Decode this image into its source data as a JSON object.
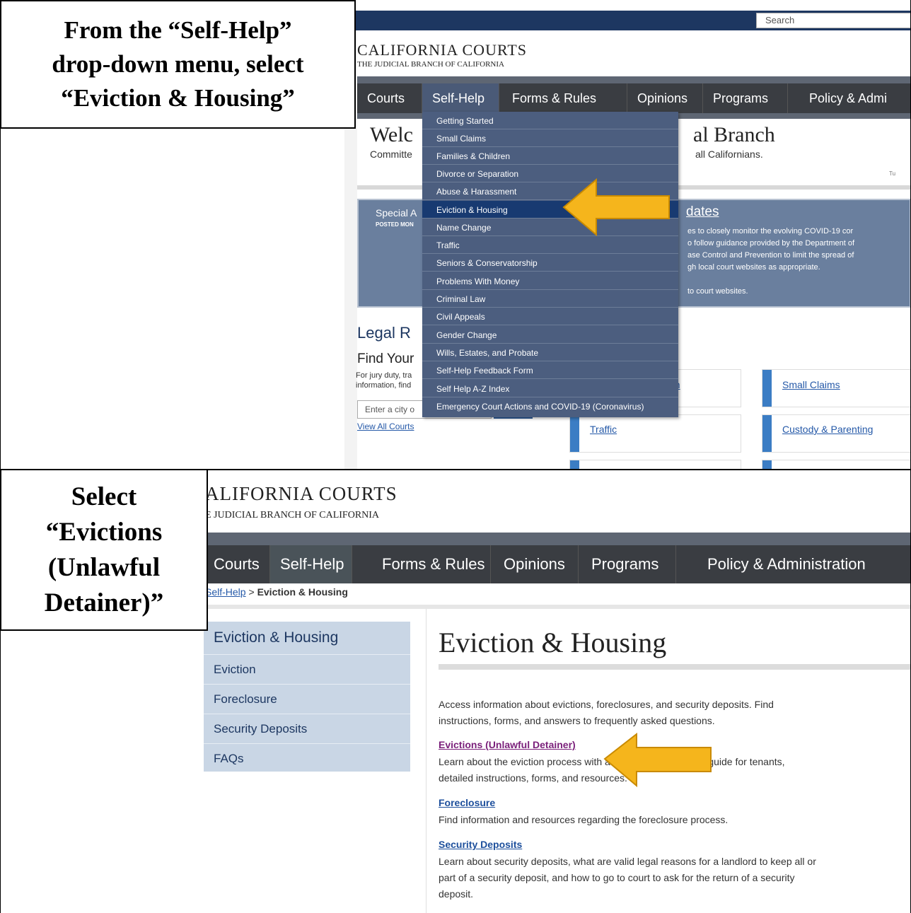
{
  "captions": {
    "top": [
      "From the “Self-Help”",
      "drop-down menu, select",
      "“Eviction & Housing”"
    ],
    "bottom": [
      "Select",
      "“Evictions",
      "(Unlawful",
      "Detainer)”"
    ]
  },
  "top_screenshot": {
    "search_placeholder": "Search",
    "logo": {
      "title": "CALIFORNIA COURTS",
      "subtitle": "THE JUDICIAL BRANCH OF CALIFORNIA"
    },
    "nav": [
      "Courts",
      "Self-Help",
      "Forms & Rules",
      "Opinions",
      "Programs",
      "Policy & Admi"
    ],
    "welcome_left": "Welc",
    "welcome_right": "al Branch",
    "tagline_left": "Committe",
    "tagline_right": "all Californians.",
    "date_fragment": "Tu",
    "special_title": "Special A",
    "posted": "POSTED MON",
    "updates_title": "dates",
    "special_text": [
      "es to closely monitor the evolving COVID-19 cor",
      "o follow guidance provided by the Department of",
      "ase Control and Prevention to limit the spread of",
      "gh local court websites as appropriate.",
      "",
      "to court websites."
    ],
    "legal_heading": "Legal R",
    "find_heading": "Find Your",
    "jury_text": [
      "For jury duty, tra",
      "information, find"
    ],
    "city_placeholder": "Enter a city o",
    "view_all": "View All Courts",
    "cards": {
      "c1": "on",
      "c2": "Small Claims",
      "c3": "Traffic",
      "c4": "Custody & Parenting"
    },
    "dropdown": [
      "Getting Started",
      "Small Claims",
      "Families & Children",
      "Divorce or Separation",
      "Abuse & Harassment",
      "Eviction & Housing",
      "Name Change",
      "Traffic",
      "Seniors & Conservatorship",
      "Problems With Money",
      "Criminal Law",
      "Civil Appeals",
      "Gender Change",
      "Wills, Estates, and Probate",
      "Self-Help Feedback Form",
      "Self Help A-Z Index",
      "Emergency Court Actions and COVID-19 (Coronavirus)"
    ],
    "highlighted_item": "Eviction & Housing"
  },
  "bottom_screenshot": {
    "logo": {
      "title": "ALIFORNIA COURTS",
      "subtitle": "E JUDICIAL BRANCH OF CALIFORNIA"
    },
    "nav": [
      "Courts",
      "Self-Help",
      "Forms & Rules",
      "Opinions",
      "Programs",
      "Policy & Administration"
    ],
    "breadcrumb": {
      "link": "Self-Help",
      "sep": " > ",
      "current": "Eviction & Housing"
    },
    "sidenav": {
      "heading": "Eviction & Housing",
      "items": [
        "Eviction",
        "Foreclosure",
        "Security Deposits",
        "FAQs"
      ]
    },
    "page_title": "Eviction & Housing",
    "intro": [
      "Access information about evictions, foreclosures, and security deposits. Find",
      "instructions, forms, and answers to frequently asked questions."
    ],
    "sections": [
      {
        "link": "Evictions (Unlawful Detainer)",
        "text": [
          "Learn about the eviction process with a guide for landlords, a guide for tenants,",
          "detailed instructions, forms, and resources."
        ]
      },
      {
        "link": "Foreclosure",
        "text": [
          "Find information and resources regarding the foreclosure process."
        ]
      },
      {
        "link": "Security Deposits",
        "text": [
          "Learn about security deposits, what are valid legal reasons for a landlord to keep all or",
          "part of a security deposit, and how to go to court to ask for the return of a security",
          "deposit."
        ]
      }
    ]
  },
  "colors": {
    "arrow": "#f5b51c",
    "nav_dark": "#3a3d42",
    "dropdown": "#4c5e7f",
    "highlight": "#183a71",
    "link_visited": "#7a1f7a"
  }
}
